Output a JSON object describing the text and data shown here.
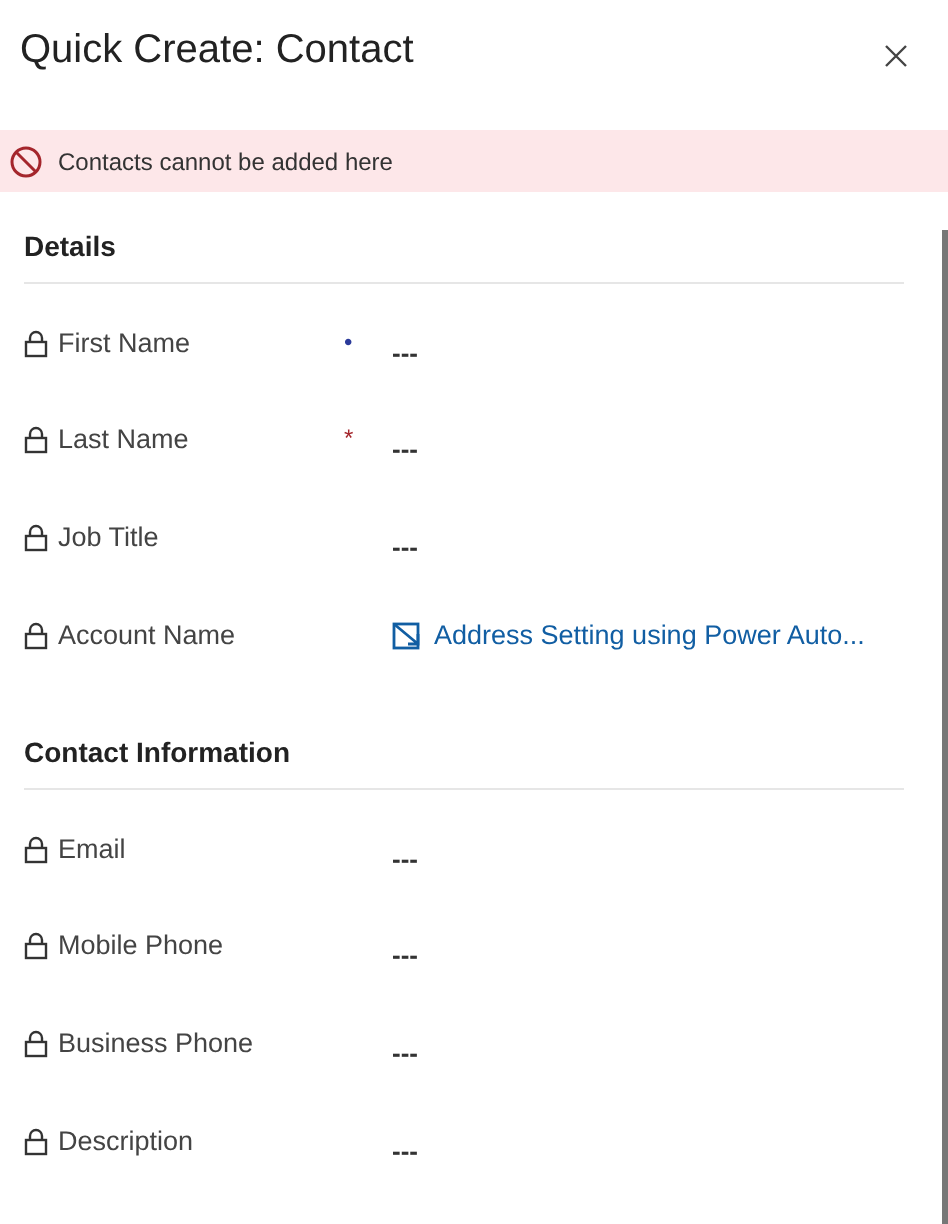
{
  "title": "Quick Create: Contact",
  "notification": {
    "kind": "error",
    "text": "Contacts cannot be added here"
  },
  "sections": [
    {
      "heading": "Details",
      "fields": [
        {
          "kind": "text",
          "label": "First Name",
          "locked": true,
          "marker": {
            "kind": "recommended",
            "text": "•"
          },
          "value": "---"
        },
        {
          "kind": "text",
          "label": "Last Name",
          "locked": true,
          "marker": {
            "kind": "required",
            "text": "*"
          },
          "value": "---"
        },
        {
          "kind": "text",
          "label": "Job Title",
          "locked": true,
          "value": "---"
        },
        {
          "kind": "lookup",
          "label": "Account Name",
          "locked": true,
          "value": "Address Setting using Power Auto..."
        }
      ]
    },
    {
      "heading": "Contact Information",
      "fields": [
        {
          "kind": "text",
          "label": "Email",
          "locked": true,
          "value": "---"
        },
        {
          "kind": "text",
          "label": "Mobile Phone",
          "locked": true,
          "value": "---"
        },
        {
          "kind": "text",
          "label": "Business Phone",
          "locked": true,
          "value": "---"
        },
        {
          "kind": "text",
          "label": "Description",
          "locked": true,
          "value": "---"
        }
      ]
    }
  ]
}
